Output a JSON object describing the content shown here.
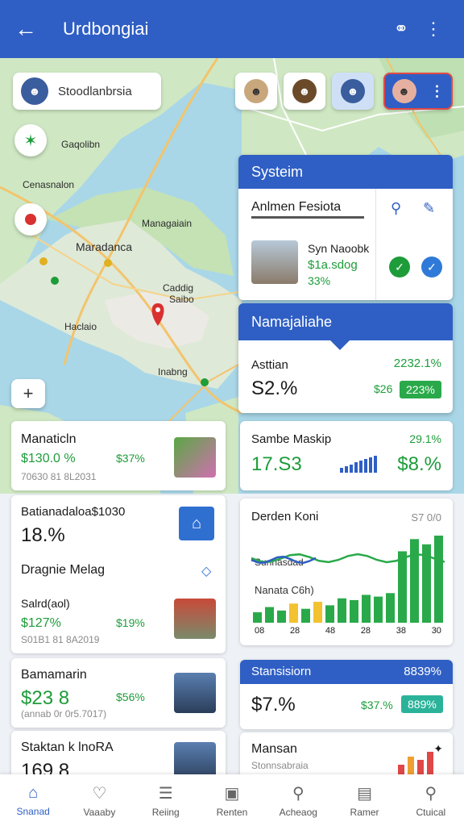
{
  "appbar": {
    "title": "Urdbongiai",
    "back_icon": "arrow-left-icon",
    "action_icon": "search-ring-icon",
    "menu_icon": "more-vert-icon"
  },
  "map": {
    "search_text": "Stoodlanbrsia",
    "labels": {
      "l1": "Gaqolibn",
      "l2": "Cenasnalon",
      "l3": "Managaiain",
      "l4": "Maradanca",
      "l5": "Caddig",
      "l6": "Saibo",
      "l7": "Haclaio",
      "l8": "Inabng"
    },
    "plus_label": "+"
  },
  "system_card": {
    "header": "Systeim",
    "name": "Anlmen Fesiota",
    "item": "Syn   Naoobk",
    "value": "$1a.sdog",
    "pct": "33%"
  },
  "market_card": {
    "header": "Namajaliahe",
    "label": "Asttian",
    "value": "S2.%",
    "pct": "2232.1%",
    "small": "$26",
    "badge": "223%"
  },
  "cards": {
    "c1": {
      "title": "Manaticln",
      "value": "$130.0 %",
      "side": "$37%",
      "muted": "70630 81 8L2031"
    },
    "c2": {
      "title": "Sambe Maskip",
      "value": "17.S3",
      "pct": "29.1%",
      "side": "$8.%"
    },
    "c3": {
      "title": "Batianadaloa$1030",
      "value": "18.%",
      "sub": "Dragnie Melag",
      "label2": "Salrd(aol)",
      "val2": "$127%",
      "side2": "$19%",
      "muted": "S01B1 81 8A2019"
    },
    "c4": {
      "title": "Derden Koni",
      "corner": "S7 0/0",
      "label_a": "Sunhasdad",
      "label_b": "Nanata C6h)",
      "ticks": [
        "08",
        "28",
        "48",
        "28",
        "38",
        "30"
      ]
    },
    "c5": {
      "title": "Bamamarin",
      "value": "$23 8",
      "side": "$56%",
      "muted": "(annab 0r 0r5.7017)"
    },
    "c6": {
      "header": "Stansisiorn",
      "header_pct": "8839%",
      "value": "$7.%",
      "side": "$37.%",
      "badge": "889%"
    },
    "c7": {
      "title": "Staktan k lnoRA",
      "value": "169 8"
    },
    "c8": {
      "title": "Mansan",
      "sub": "Stonnsabraia"
    }
  },
  "chart_data": {
    "type": "bar",
    "title": "Derden Koni",
    "categories": [
      "08",
      "28",
      "48",
      "28",
      "38",
      "30"
    ],
    "series": [
      {
        "values": [
          12,
          18,
          14,
          22,
          16,
          24,
          20,
          28,
          26,
          32,
          30,
          34,
          82,
          96,
          90,
          100
        ]
      }
    ]
  },
  "bottom_nav": [
    {
      "label": "Snanad",
      "icon": "home-icon",
      "active": true
    },
    {
      "label": "Vaaaby",
      "icon": "heart-icon",
      "active": false
    },
    {
      "label": "Reiing",
      "icon": "list-icon",
      "active": false
    },
    {
      "label": "Renten",
      "icon": "box-icon",
      "active": false
    },
    {
      "label": "Acheaog",
      "icon": "search-icon",
      "active": false
    },
    {
      "label": "Ramer",
      "icon": "note-icon",
      "active": false
    },
    {
      "label": "Ctuical",
      "icon": "magnifier-icon",
      "active": false
    }
  ],
  "colors": {
    "primary": "#2f5fc4",
    "green": "#1e9c3a",
    "accent_red": "#e04848"
  }
}
